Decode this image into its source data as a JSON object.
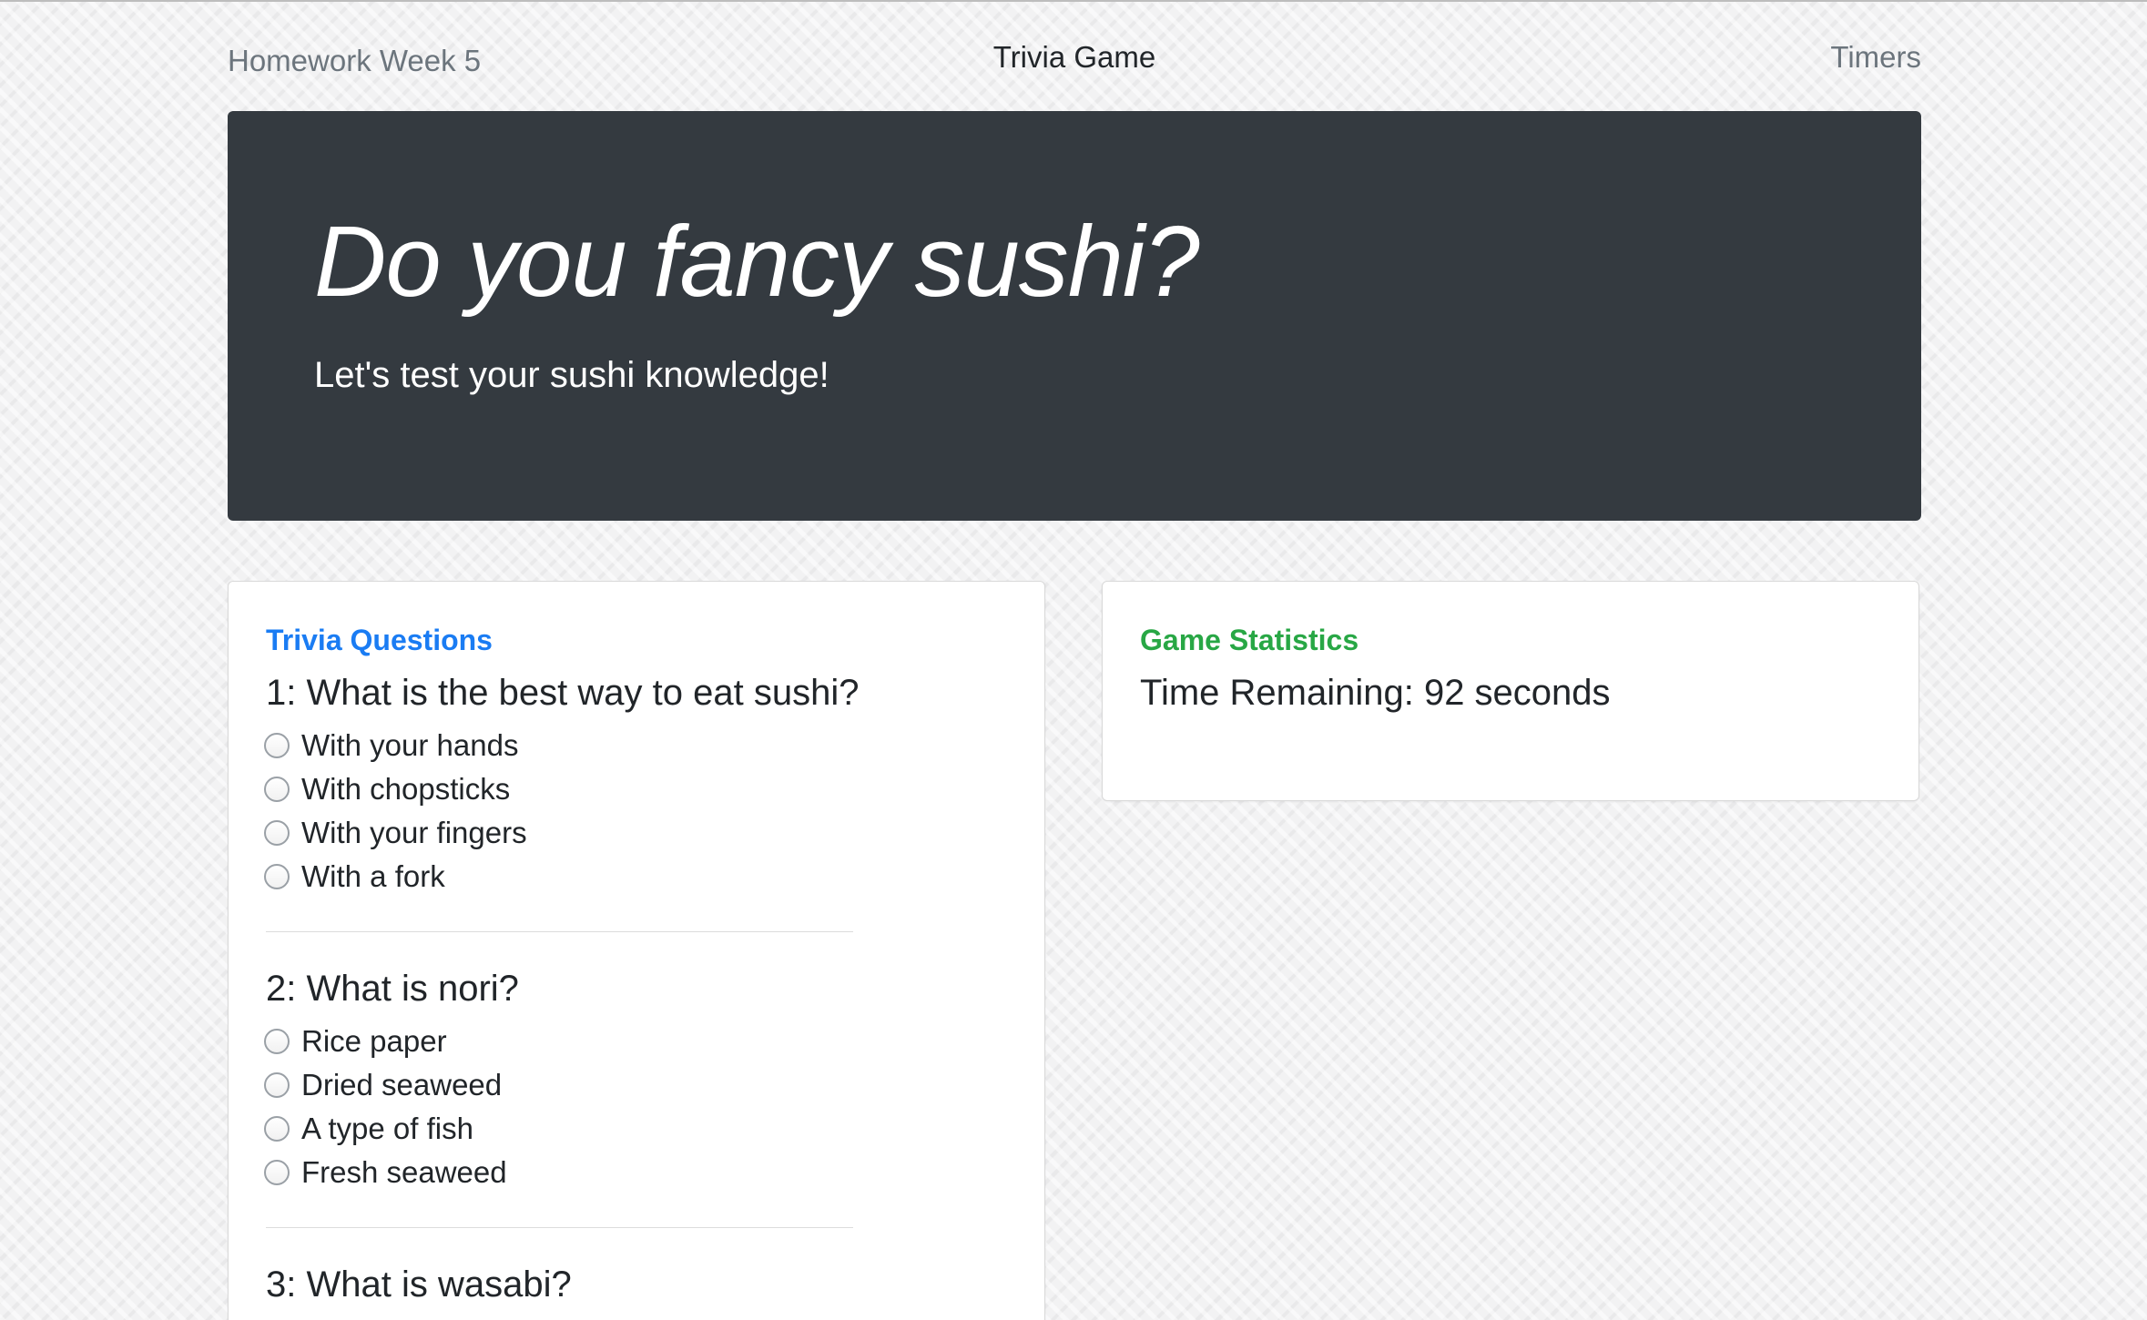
{
  "nav": {
    "brand": "Homework Week 5",
    "title": "Trivia Game",
    "timers_link": "Timers"
  },
  "jumbotron": {
    "heading": "Do you fancy sushi?",
    "lead": "Let's test your sushi knowledge!"
  },
  "trivia": {
    "title": "Trivia Questions",
    "questions": [
      {
        "text": "1: What is the best way to eat sushi?",
        "answers": [
          "With your hands",
          "With chopsticks",
          "With your fingers",
          "With a fork"
        ]
      },
      {
        "text": "2: What is nori?",
        "answers": [
          "Rice paper",
          "Dried seaweed",
          "A type of fish",
          "Fresh seaweed"
        ]
      },
      {
        "text": "3: What is wasabi?",
        "answers": []
      }
    ]
  },
  "stats": {
    "title": "Game Statistics",
    "time_remaining": "Time Remaining: 92 seconds"
  },
  "colors": {
    "jumbotron_bg": "#343a40",
    "trivia_title": "#1a7cf3",
    "stats_title": "#28a745"
  }
}
